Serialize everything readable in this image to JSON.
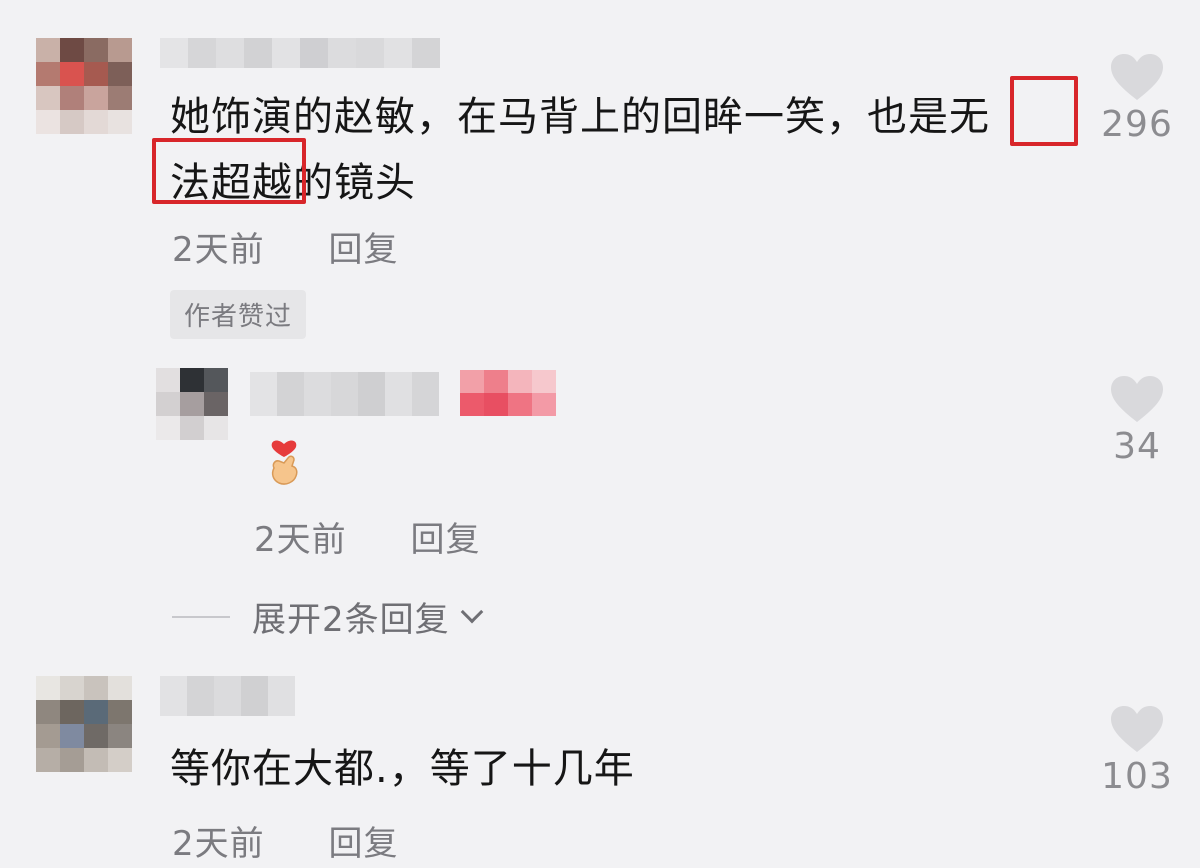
{
  "colors": {
    "background": "#f2f2f4",
    "highlight_box": "#d8262a",
    "meta_text": "#7b7b80",
    "like_icon": "#d9d9dc"
  },
  "comments": [
    {
      "text_line1": "她饰演的赵敏，在马背上的回眸一笑，也是无",
      "text_line2": "法超越的镜头",
      "time": "2天前",
      "reply_label": "回复",
      "badge": "作者赞过",
      "likes": "296",
      "like_icon": "heart-icon"
    },
    {
      "emoji": "finger-heart-emoji",
      "time": "2天前",
      "reply_label": "回复",
      "likes": "34",
      "like_icon": "heart-icon"
    },
    {
      "text_line1": "等你在大都.，等了十几年",
      "time": "2天前",
      "reply_label": "回复",
      "likes": "103",
      "like_icon": "heart-icon"
    }
  ],
  "expand_replies": {
    "label": "展开2条回复",
    "icon": "chevron-down-icon"
  }
}
